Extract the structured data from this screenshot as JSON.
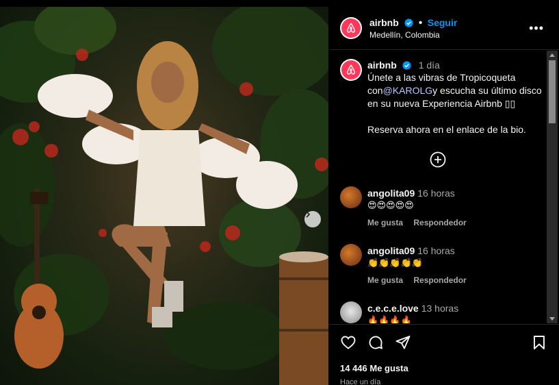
{
  "post": {
    "account": "airbnb",
    "follow_label": "Seguir",
    "location": "Medellín, Colombia",
    "more_label": "•••"
  },
  "caption": {
    "username": "airbnb",
    "time": "1 día",
    "text_before": "Únete a las vibras de Tropicoqueta con",
    "mention": "@KAROLG",
    "text_after": "y escucha su último disco en su nueva Experiencia Airbnb ▯▯",
    "line2": "Reserva ahora en el enlace de la bio."
  },
  "comments": [
    {
      "user": "angolita09",
      "time": "16 horas",
      "text": "😍😍😍😍😍",
      "like_label": "Me gusta",
      "reply_label": "Respondedor"
    },
    {
      "user": "angolita09",
      "time": "16 horas",
      "text": "👏👏👏👏👏",
      "like_label": "Me gusta",
      "reply_label": "Respondedor"
    },
    {
      "user": "c.e.c.e.love",
      "time": "13 horas",
      "text": "🔥🔥🔥🔥"
    }
  ],
  "footer": {
    "likes": "14 446 Me gusta",
    "posted": "Hace un día"
  },
  "colors": {
    "brand": "#ff385c",
    "link": "#0095f6",
    "background": "#000000"
  },
  "icons": [
    "airbnb-logo-icon",
    "verified-badge-icon",
    "more-options-icon",
    "add-comment-icon",
    "heart-icon",
    "comment-icon",
    "share-icon",
    "bookmark-icon",
    "chevron-right-icon"
  ]
}
